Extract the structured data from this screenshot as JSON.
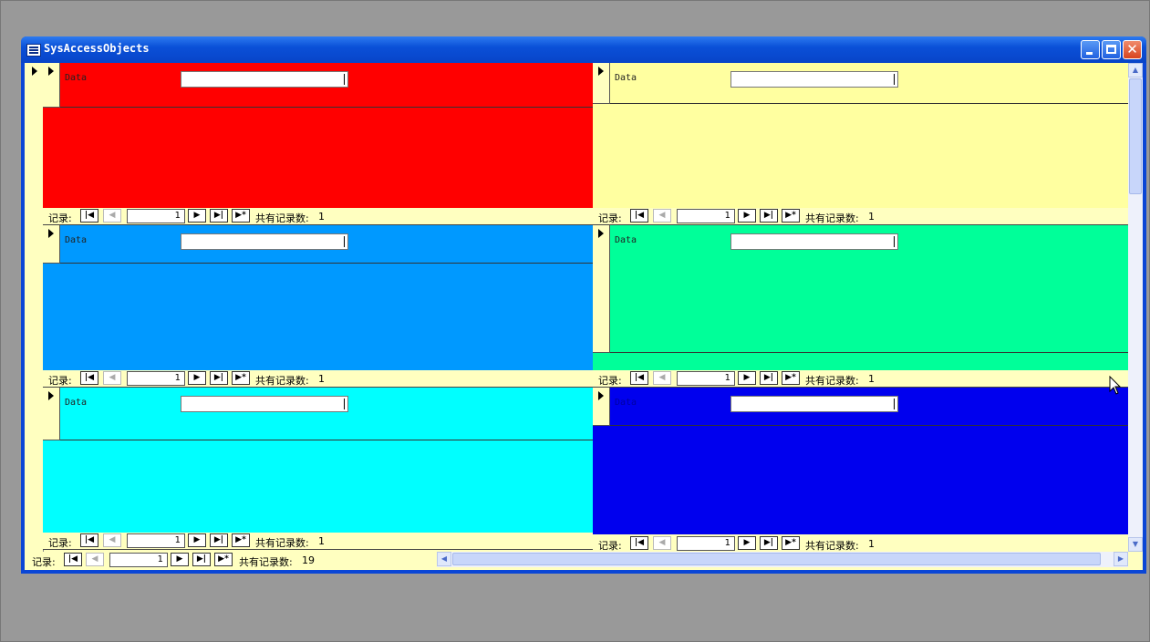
{
  "window": {
    "title": "SysAccessObjects"
  },
  "field_label": "Data",
  "nav": {
    "record_label": "记录:",
    "current": "1",
    "count_label": "共有记录数:",
    "btn_first": "|◀",
    "btn_prev": "◀",
    "btn_next": "▶",
    "btn_last": "▶|",
    "btn_new": "▶*"
  },
  "subforms": [
    {
      "detail_color": "#ff0000",
      "header_color": "#ff0000",
      "count": "1"
    },
    {
      "detail_color": "#ffffa0",
      "header_color": "#ffffa0",
      "count": "1"
    },
    {
      "detail_color": "#0099ff",
      "header_color": "#0099ff",
      "count": "1"
    },
    {
      "detail_color": "#00ff99",
      "header_color": "#00ff99",
      "count": "1"
    },
    {
      "detail_color": "#00ffff",
      "header_color": "#00ffff",
      "count": "1"
    },
    {
      "detail_color": "#0000ee",
      "header_color": "#0000ee",
      "count": "1"
    }
  ],
  "main_nav": {
    "current": "1",
    "count": "19"
  },
  "colors": {
    "form_back": "#ffffc0",
    "title_bar": "#0a50d8"
  }
}
